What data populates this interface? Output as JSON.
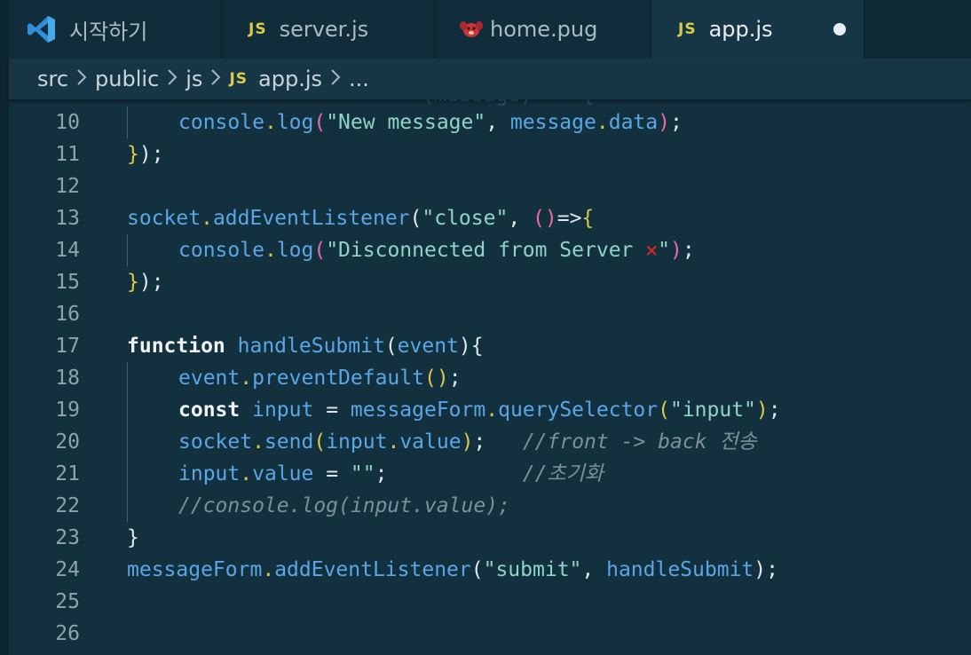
{
  "tabs": [
    {
      "label": "시작하기",
      "icon": "vscode-logo-icon",
      "active": false
    },
    {
      "label": "server.js",
      "icon": "js-icon",
      "active": false
    },
    {
      "label": "home.pug",
      "icon": "pug-icon",
      "active": false
    },
    {
      "label": "app.js",
      "icon": "js-icon",
      "active": true,
      "modified": true
    }
  ],
  "breadcrumb": [
    "src",
    "public",
    "js",
    "app.js",
    "..."
  ],
  "breadcrumb_separator": ">",
  "editor": {
    "ghost_text": "                        (message) => {",
    "lines": [
      {
        "n": "10",
        "tokens": [
          {
            "t": "console",
            "c": "k-var"
          },
          {
            "t": ".",
            "c": "k-dot"
          },
          {
            "t": "log",
            "c": "k-fn"
          },
          {
            "t": "(",
            "c": "k-paren"
          },
          {
            "t": "\"New message\"",
            "c": "k-str"
          },
          {
            "t": ", ",
            "c": "k-plain"
          },
          {
            "t": "message",
            "c": "k-var"
          },
          {
            "t": ".",
            "c": "k-dot"
          },
          {
            "t": "data",
            "c": "k-var"
          },
          {
            "t": ")",
            "c": "k-paren"
          },
          {
            "t": ";",
            "c": "k-plain"
          }
        ],
        "indent": 1
      },
      {
        "n": "11",
        "tokens": [
          {
            "t": "}",
            "c": "k-brace"
          },
          {
            "t": ");",
            "c": "k-plain"
          }
        ],
        "indent": 0
      },
      {
        "n": "12",
        "tokens": [],
        "indent": 0
      },
      {
        "n": "13",
        "tokens": [
          {
            "t": "socket",
            "c": "k-var"
          },
          {
            "t": ".",
            "c": "k-dot"
          },
          {
            "t": "addEventListener",
            "c": "k-fn"
          },
          {
            "t": "(",
            "c": "k-plain"
          },
          {
            "t": "\"close\"",
            "c": "k-str"
          },
          {
            "t": ", ",
            "c": "k-plain"
          },
          {
            "t": "()",
            "c": "k-paren"
          },
          {
            "t": "=>",
            "c": "k-plain"
          },
          {
            "t": "{",
            "c": "k-brace"
          }
        ],
        "indent": 0
      },
      {
        "n": "14",
        "tokens": [
          {
            "t": "console",
            "c": "k-var"
          },
          {
            "t": ".",
            "c": "k-dot"
          },
          {
            "t": "log",
            "c": "k-fn"
          },
          {
            "t": "(",
            "c": "k-paren"
          },
          {
            "t": "\"Disconnected from Server ",
            "c": "k-str"
          },
          {
            "t": "✕",
            "c": "x-mark"
          },
          {
            "t": "\"",
            "c": "k-str"
          },
          {
            "t": ")",
            "c": "k-paren"
          },
          {
            "t": ";",
            "c": "k-plain"
          }
        ],
        "indent": 1
      },
      {
        "n": "15",
        "tokens": [
          {
            "t": "}",
            "c": "k-brace"
          },
          {
            "t": ");",
            "c": "k-plain"
          }
        ],
        "indent": 0
      },
      {
        "n": "16",
        "tokens": [],
        "indent": 0
      },
      {
        "n": "17",
        "tokens": [
          {
            "t": "function",
            "c": "k-bold"
          },
          {
            "t": " ",
            "c": "k-plain"
          },
          {
            "t": "handleSubmit",
            "c": "k-fn"
          },
          {
            "t": "(",
            "c": "k-plain"
          },
          {
            "t": "event",
            "c": "k-var"
          },
          {
            "t": "){",
            "c": "k-plain"
          }
        ],
        "indent": 0
      },
      {
        "n": "18",
        "tokens": [
          {
            "t": "event",
            "c": "k-var"
          },
          {
            "t": ".",
            "c": "k-dot"
          },
          {
            "t": "preventDefault",
            "c": "k-fn"
          },
          {
            "t": "()",
            "c": "k-brace"
          },
          {
            "t": ";",
            "c": "k-plain"
          }
        ],
        "indent": 1
      },
      {
        "n": "19",
        "tokens": [
          {
            "t": "const",
            "c": "k-bold"
          },
          {
            "t": " ",
            "c": "k-plain"
          },
          {
            "t": "input",
            "c": "k-var"
          },
          {
            "t": " = ",
            "c": "k-plain"
          },
          {
            "t": "messageForm",
            "c": "k-var"
          },
          {
            "t": ".",
            "c": "k-dot"
          },
          {
            "t": "querySelector",
            "c": "k-fn"
          },
          {
            "t": "(",
            "c": "k-brace"
          },
          {
            "t": "\"input\"",
            "c": "k-str"
          },
          {
            "t": ")",
            "c": "k-brace"
          },
          {
            "t": ";",
            "c": "k-plain"
          }
        ],
        "indent": 1
      },
      {
        "n": "20",
        "tokens": [
          {
            "t": "socket",
            "c": "k-var"
          },
          {
            "t": ".",
            "c": "k-dot"
          },
          {
            "t": "send",
            "c": "k-fn"
          },
          {
            "t": "(",
            "c": "k-brace"
          },
          {
            "t": "input",
            "c": "k-var"
          },
          {
            "t": ".",
            "c": "k-dot"
          },
          {
            "t": "value",
            "c": "k-var"
          },
          {
            "t": ")",
            "c": "k-brace"
          },
          {
            "t": ";   ",
            "c": "k-plain"
          },
          {
            "t": "//front -> back 전송",
            "c": "k-cmt"
          }
        ],
        "indent": 1
      },
      {
        "n": "21",
        "tokens": [
          {
            "t": "input",
            "c": "k-var"
          },
          {
            "t": ".",
            "c": "k-dot"
          },
          {
            "t": "value",
            "c": "k-var"
          },
          {
            "t": " = ",
            "c": "k-plain"
          },
          {
            "t": "\"\"",
            "c": "k-str"
          },
          {
            "t": ";           ",
            "c": "k-plain"
          },
          {
            "t": "//초기화",
            "c": "k-cmt"
          }
        ],
        "indent": 1
      },
      {
        "n": "22",
        "tokens": [
          {
            "t": "//console.log(input.value);",
            "c": "k-cmt"
          }
        ],
        "indent": 1
      },
      {
        "n": "23",
        "tokens": [
          {
            "t": "}",
            "c": "k-plain"
          }
        ],
        "indent": 0
      },
      {
        "n": "24",
        "tokens": [
          {
            "t": "messageForm",
            "c": "k-var"
          },
          {
            "t": ".",
            "c": "k-dot"
          },
          {
            "t": "addEventListener",
            "c": "k-fn"
          },
          {
            "t": "(",
            "c": "k-plain"
          },
          {
            "t": "\"submit\"",
            "c": "k-str"
          },
          {
            "t": ", ",
            "c": "k-plain"
          },
          {
            "t": "handleSubmit",
            "c": "k-fn"
          },
          {
            "t": ");",
            "c": "k-plain"
          }
        ],
        "indent": 0
      },
      {
        "n": "25",
        "tokens": [],
        "indent": 0
      },
      {
        "n": "26",
        "tokens": [],
        "indent": 0
      }
    ]
  },
  "colors": {
    "background": "#13303e",
    "tabbar": "#0f2937",
    "active_tab": "#163645",
    "js_badge": "#d9cc4a",
    "string": "#8fd4c4",
    "identifier": "#5aa6e6",
    "comment": "#7b909a"
  }
}
